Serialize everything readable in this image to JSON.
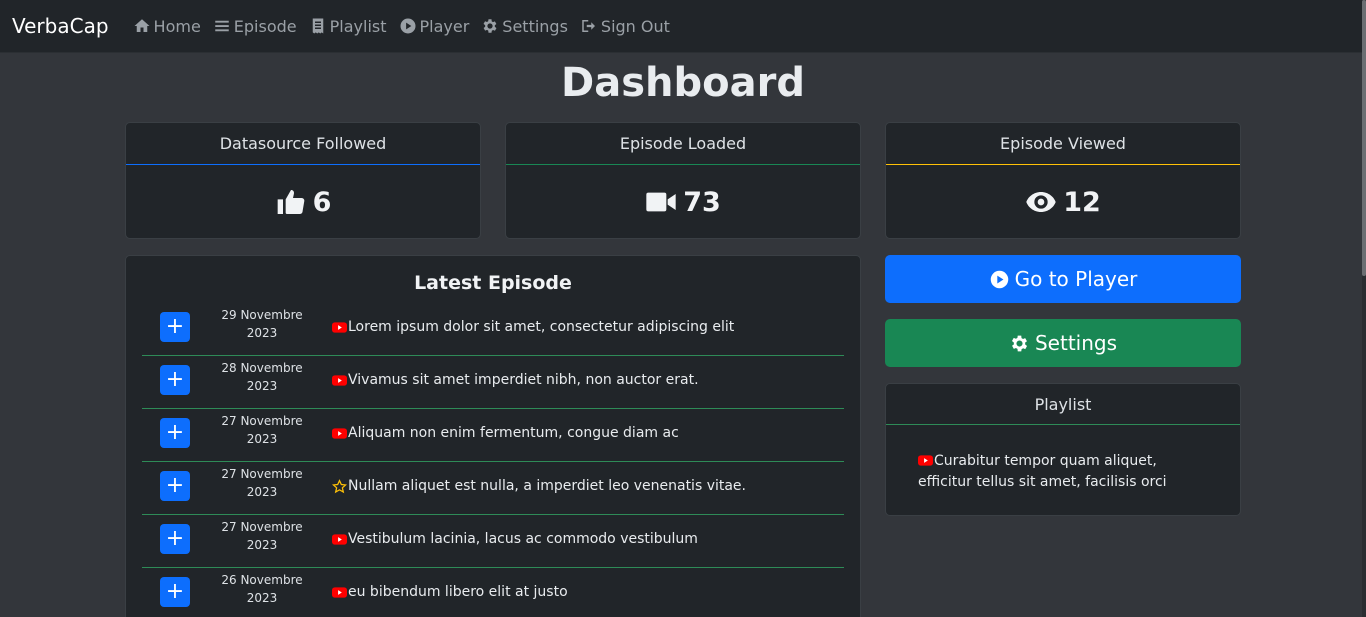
{
  "nav": {
    "brand": "VerbaCap",
    "items": [
      {
        "label": "Home",
        "icon": "home-icon"
      },
      {
        "label": "Episode",
        "icon": "list-icon"
      },
      {
        "label": "Playlist",
        "icon": "receipt-icon"
      },
      {
        "label": "Player",
        "icon": "play-circle-icon"
      },
      {
        "label": "Settings",
        "icon": "gear-icon"
      },
      {
        "label": "Sign Out",
        "icon": "sign-out-icon"
      }
    ]
  },
  "page_title": "Dashboard",
  "stats": [
    {
      "label": "Datasource Followed",
      "value": "6",
      "icon": "thumbs-up-icon",
      "accent": "#0d6efd"
    },
    {
      "label": "Episode Loaded",
      "value": "73",
      "icon": "video-icon",
      "accent": "#198754"
    },
    {
      "label": "Episode Viewed",
      "value": "12",
      "icon": "eye-icon",
      "accent": "#ffc107"
    }
  ],
  "latest": {
    "title": "Latest Episode",
    "episodes": [
      {
        "date_day": "29 Novembre",
        "date_year": "2023",
        "title": "Lorem ipsum dolor sit amet, consectetur adipiscing elit",
        "icon": "youtube-icon"
      },
      {
        "date_day": "28 Novembre",
        "date_year": "2023",
        "title": "Vivamus sit amet imperdiet nibh, non auctor erat.",
        "icon": "youtube-icon"
      },
      {
        "date_day": "27 Novembre",
        "date_year": "2023",
        "title": "Aliquam non enim fermentum, congue diam ac",
        "icon": "youtube-icon"
      },
      {
        "date_day": "27 Novembre",
        "date_year": "2023",
        "title": "Nullam aliquet est nulla, a imperdiet leo venenatis vitae.",
        "icon": "star-icon"
      },
      {
        "date_day": "27 Novembre",
        "date_year": "2023",
        "title": "Vestibulum lacinia, lacus ac commodo vestibulum",
        "icon": "youtube-icon"
      },
      {
        "date_day": "26 Novembre",
        "date_year": "2023",
        "title": "eu bibendum libero elit at justo",
        "icon": "youtube-icon"
      }
    ]
  },
  "actions": {
    "player_label": "Go to Player",
    "settings_label": "Settings"
  },
  "playlist": {
    "title": "Playlist",
    "item": "Curabitur tempor quam aliquet, efficitur tellus sit amet, facilisis orci"
  },
  "colors": {
    "navbar_bg": "#212529",
    "page_bg": "#33363b",
    "primary": "#0d6efd",
    "success": "#198754",
    "youtube_red": "#ff0000",
    "star": "#ffc107"
  }
}
